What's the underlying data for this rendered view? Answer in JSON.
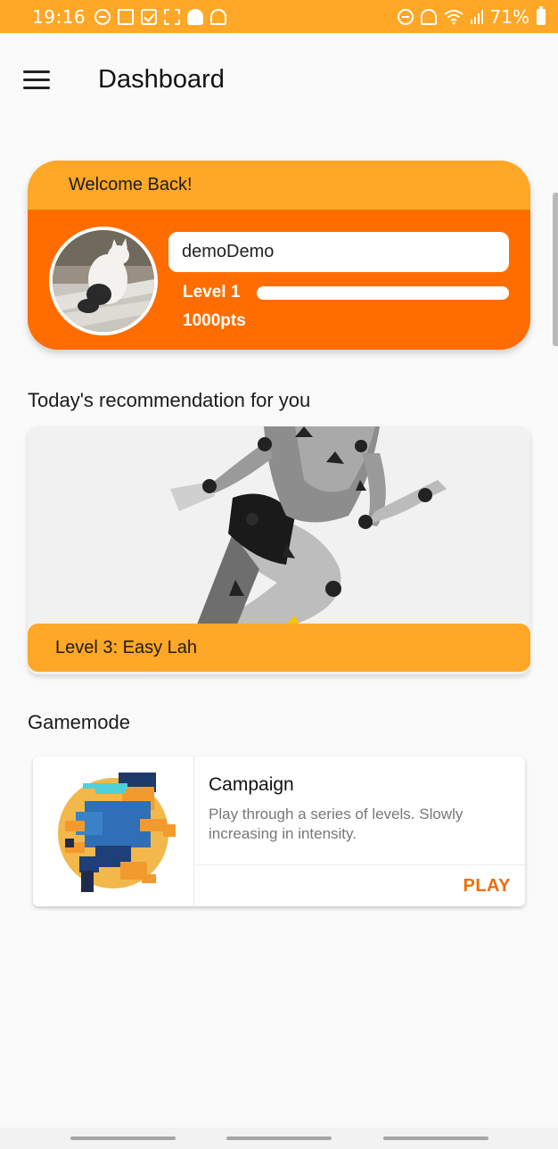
{
  "status_bar": {
    "time": "19:16",
    "battery": "71%",
    "left_icons": [
      "do-not-disturb-icon",
      "news-app-icon",
      "check-task-icon",
      "screenshot-icon",
      "snapchat-icon",
      "sync-off-icon"
    ],
    "right_icons": [
      "alarm-icon",
      "mute-icon",
      "wifi-icon",
      "signal-icon",
      "battery-icon"
    ]
  },
  "appbar": {
    "menu_icon": "hamburger-menu-icon",
    "title": "Dashboard"
  },
  "profile": {
    "welcome": "Welcome Back!",
    "username": "demoDemo",
    "level": "Level 1",
    "level_progress": 1.0,
    "points": "1000pts",
    "avatar": "cat-photo-avatar"
  },
  "recommendation": {
    "section_title": "Today's recommendation for you",
    "level_title": "Level 3: Easy Lah",
    "image": "running-mannequin-illustration"
  },
  "gamemode": {
    "section_title": "Gamemode",
    "card": {
      "title": "Campaign",
      "description": "Play through a series of levels. Slowly increasing in intensity.",
      "action": "PLAY",
      "image": "pixel-runner-illustration"
    }
  },
  "colors": {
    "primary_orange": "#ff6d00",
    "accent_amber": "#ffa726",
    "action_orange": "#ef6c00"
  }
}
